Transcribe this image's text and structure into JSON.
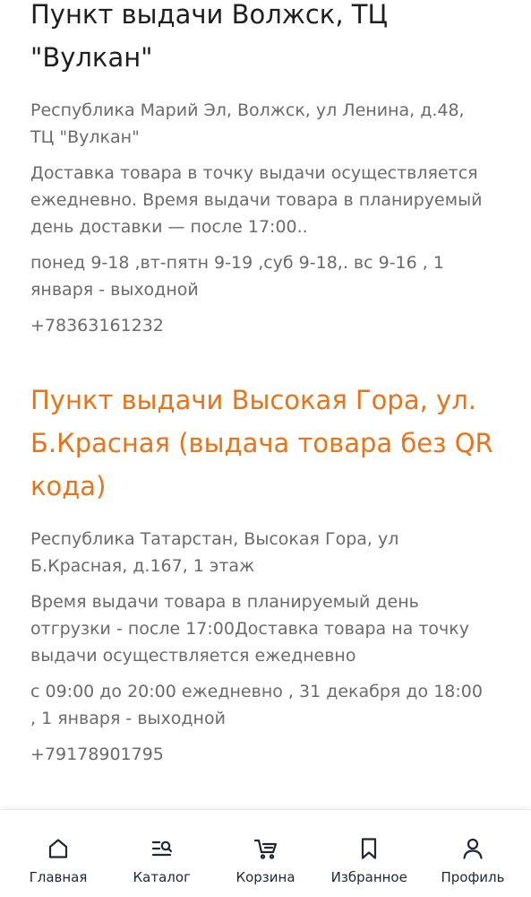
{
  "stores": [
    {
      "title_lines": [
        "Пункт выдачи Волжск, ТЦ",
        "\"Вулкан\""
      ],
      "title_color": "#1f1f1f",
      "address_lines": [
        "Республика Марий Эл, Волжск, ул Ленина, д.48,",
        "ТЦ \"Вулкан\""
      ],
      "delivery_lines": [
        "Доставка товара в точку выдачи осуществляется",
        "ежедневно. Время выдачи товара в планируемый",
        "день доставки — после 17:00.."
      ],
      "hours_lines": [
        "понед 9-18 ,вт-пятн 9-19 ,суб 9-18,. вс 9-16 , 1",
        "января - выходной"
      ],
      "phone": "+78363161232"
    },
    {
      "title_lines": [
        "Пункт выдачи Высокая Гора, ул.",
        "Б.Красная (выдача товара без QR",
        "кода)"
      ],
      "title_color": "#e8731a",
      "address_lines": [
        "Республика Татарстан, Высокая Гора, ул",
        "Б.Красная, д.167, 1 этаж"
      ],
      "delivery_lines": [
        "Время выдачи товара в планируемый день",
        "отгрузки - после 17:00Доставка товара на точку",
        "выдачи осуществляется ежедневно"
      ],
      "hours_lines": [
        "с 09:00 до 20:00 ежедневно , 31 декабря до 18:00",
        ", 1 января - выходной"
      ],
      "phone": "+79178901795"
    }
  ],
  "tabbar": {
    "items": [
      {
        "label": "Главная",
        "icon": "home-icon"
      },
      {
        "label": "Каталог",
        "icon": "catalog-icon"
      },
      {
        "label": "Корзина",
        "icon": "cart-icon"
      },
      {
        "label": "Избранное",
        "icon": "bookmark-icon"
      },
      {
        "label": "Профиль",
        "icon": "profile-icon"
      }
    ]
  },
  "colors": {
    "accent": "#e8731a",
    "text_dark": "#1f1f1f",
    "text_muted": "#6b6b6b",
    "icon": "#1e2733"
  }
}
